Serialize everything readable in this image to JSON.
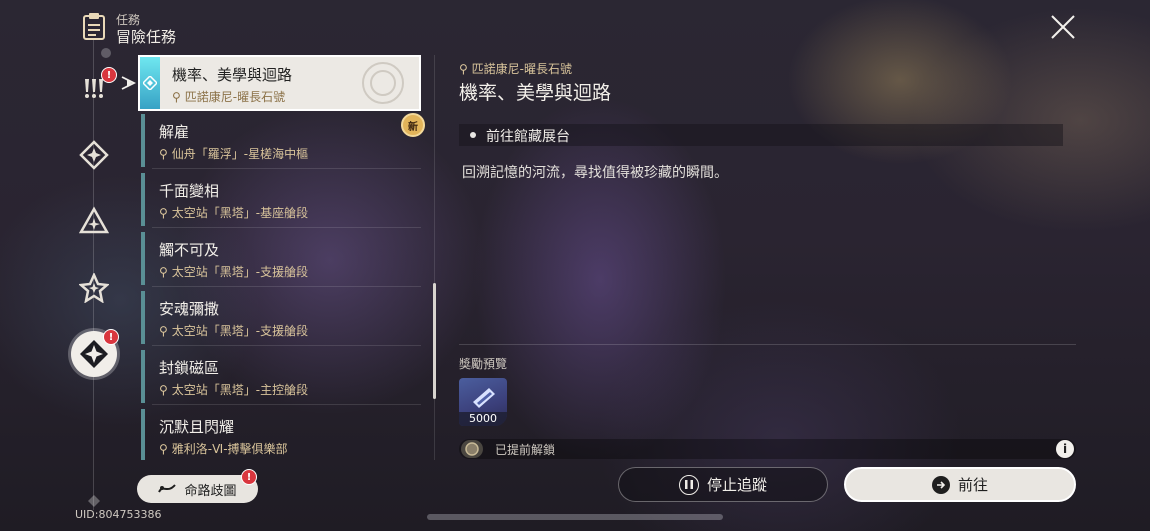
{
  "header": {
    "subtitle": "任務",
    "title": "冒險任務"
  },
  "sidebar": {
    "tabs": [
      {
        "name": "trailblaze",
        "badge": "!"
      },
      {
        "name": "companion"
      },
      {
        "name": "adventure"
      },
      {
        "name": "daily"
      },
      {
        "name": "event",
        "badge": "!"
      }
    ]
  },
  "quest_list": [
    {
      "title": "機率、美學與迴路",
      "location": "匹諾康尼-曜長石號",
      "selected": true
    },
    {
      "title": "解雇",
      "location": "仙舟「羅浮」-星槎海中樞",
      "new": "新"
    },
    {
      "title": "千面變相",
      "location": "太空站「黑塔」-基座艙段"
    },
    {
      "title": "觸不可及",
      "location": "太空站「黑塔」-支援艙段"
    },
    {
      "title": "安魂彌撒",
      "location": "太空站「黑塔」-支援艙段"
    },
    {
      "title": "封鎖磁區",
      "location": "太空站「黑塔」-主控艙段"
    },
    {
      "title": "沉默且閃耀",
      "location": "雅利洛-Ⅵ-搏擊俱樂部"
    }
  ],
  "detail": {
    "location": "匹諾康尼-曜長石號",
    "title": "機率、美學與迴路",
    "objective": "前往館藏展台",
    "description": "回溯記憶的河流，尋找值得被珍藏的瞬間。"
  },
  "rewards": {
    "label": "獎勵預覽",
    "items": [
      {
        "icon": "trailblaze-exp-icon",
        "count": "5000"
      }
    ],
    "unlock_text": "已提前解鎖"
  },
  "buttons": {
    "stop": "停止追蹤",
    "go": "前往",
    "branch": "命路歧圖",
    "branch_badge": "!"
  },
  "uid": "UID:804753386",
  "colors": {
    "accent_cyan": "#37a2c5",
    "gold": "#d9c49b",
    "badge_red": "#d9363e"
  }
}
